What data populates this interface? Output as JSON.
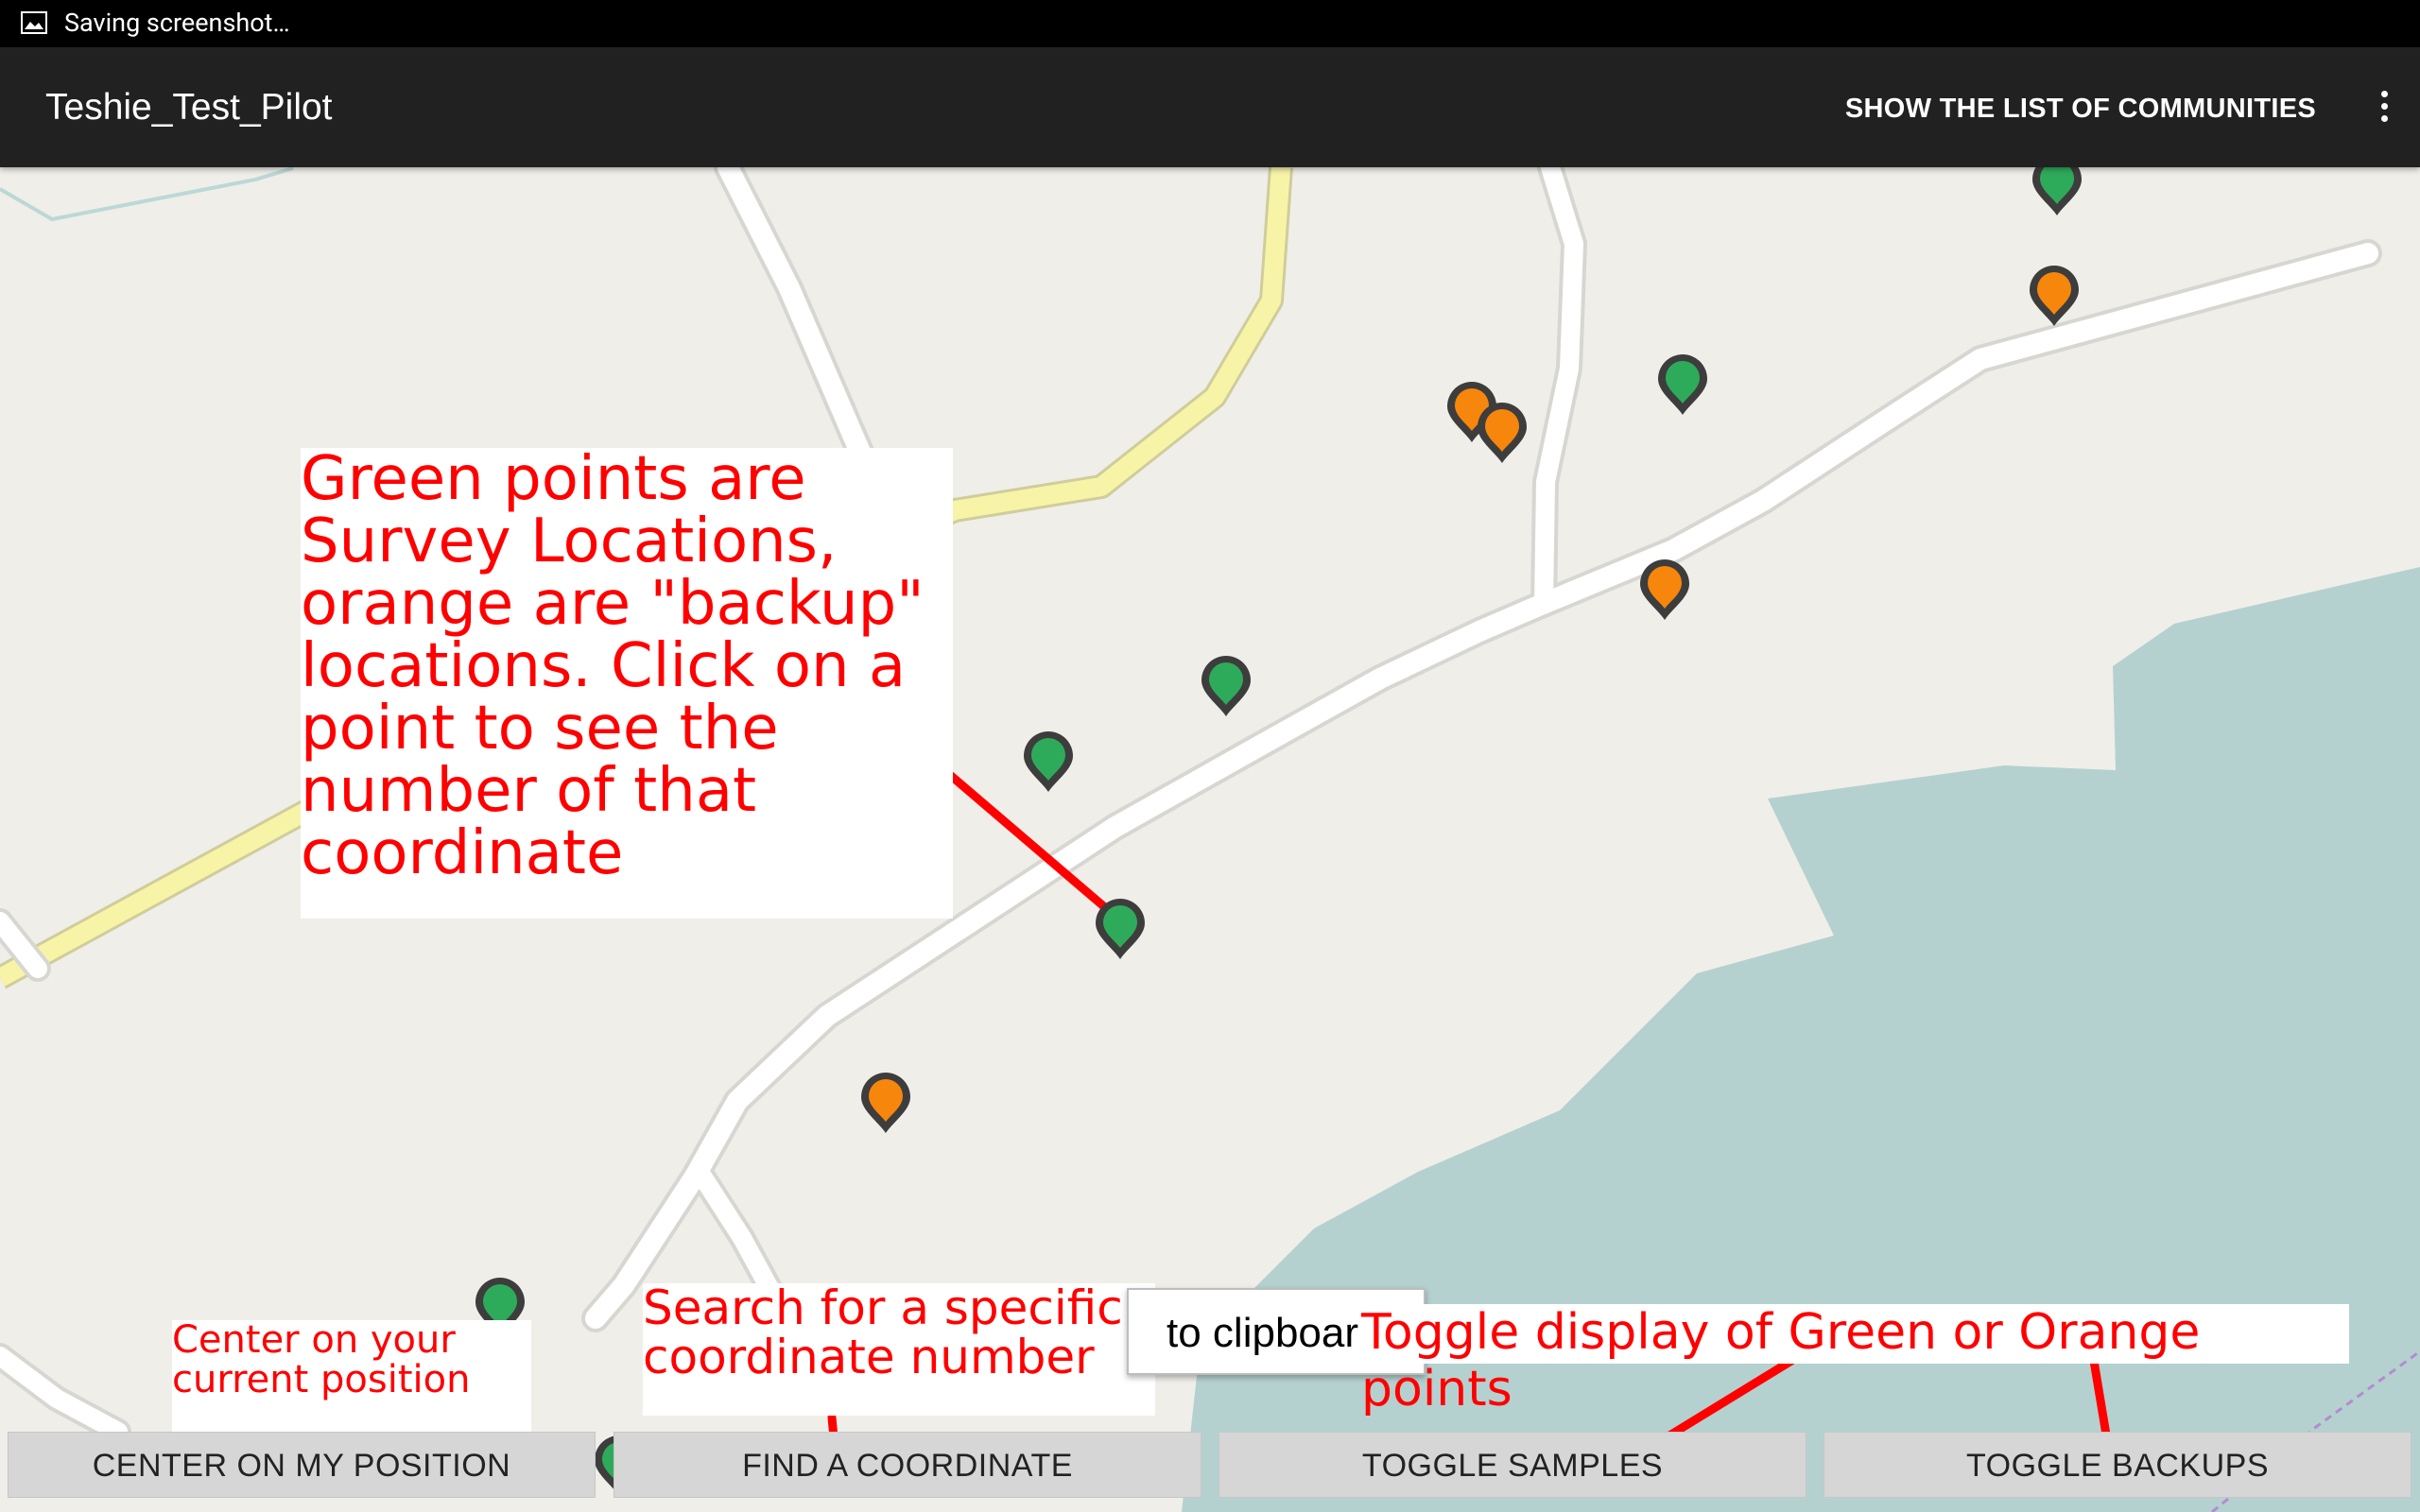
{
  "status_bar": {
    "text": "Saving screenshot…"
  },
  "action_bar": {
    "title": "Teshie_Test_Pilot",
    "show_list_label": "SHOW THE LIST OF COMMUNITIES"
  },
  "map": {
    "marker_colors": {
      "survey": "#2eab5a",
      "backup": "#f7860d"
    },
    "water_color": "#b4d1d0",
    "land_color": "#f0eee9",
    "road_color": "#ffffff",
    "primary_road_color": "#f7f4a8"
  },
  "annotations": {
    "main": "Green points are\nSurvey Locations,\norange are \"backup\"\nlocations. Click on a\npoint to see the\nnumber of that\ncoordinate",
    "center": "Center on your\ncurrent position",
    "find": "Search for a specific\ncoordinate number",
    "toggle": "Toggle display of Green or Orange points"
  },
  "toast": {
    "text": "to clipboar"
  },
  "buttons": {
    "center": "CENTER ON MY POSITION",
    "find": "FIND A COORDINATE",
    "toggle_samples": "TOGGLE SAMPLES",
    "toggle_backups": "TOGGLE BACKUPS"
  }
}
